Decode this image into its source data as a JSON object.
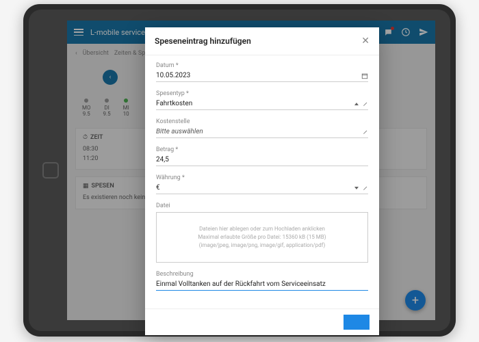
{
  "header": {
    "title": "L-mobile service"
  },
  "breadcrumb": {
    "a": "Übersicht",
    "b": "Zeiten & Spesen"
  },
  "week": [
    {
      "day": "MO",
      "val": "9.5"
    },
    {
      "day": "DI",
      "val": "9.5"
    },
    {
      "day": "MI",
      "val": "10"
    }
  ],
  "sections": {
    "zeit": {
      "title": "ZEIT",
      "t1": "08:30",
      "t2": "11:20"
    },
    "spesen": {
      "title": "SPESEN",
      "empty": "Es existieren noch keine Speseneinträge"
    }
  },
  "modal": {
    "title": "Speseneintrag hinzufügen",
    "fields": {
      "datum": {
        "label": "Datum *",
        "value": "10.05.2023"
      },
      "spesentyp": {
        "label": "Spesentyp *",
        "value": "Fahrtkosten"
      },
      "kostenstelle": {
        "label": "Kostenstelle",
        "placeholder": "Bitte auswählen"
      },
      "betrag": {
        "label": "Betrag *",
        "value": "24,5"
      },
      "waehrung": {
        "label": "Währung *",
        "value": "€"
      },
      "datei": {
        "label": "Datei"
      },
      "beschreibung": {
        "label": "Beschreibung",
        "value": "Einmal Volltanken auf der Rückfahrt vom Serviceeinsatz"
      }
    },
    "dropzone": {
      "line1": "Dateien hier ablegen oder zum Hochladen anklicken",
      "line2": "Maximal erlaubte Größe pro Datei: 15360 kB (15 MB)",
      "line3": "(image/jpeg, image/png, image/gif, application/pdf)"
    }
  }
}
